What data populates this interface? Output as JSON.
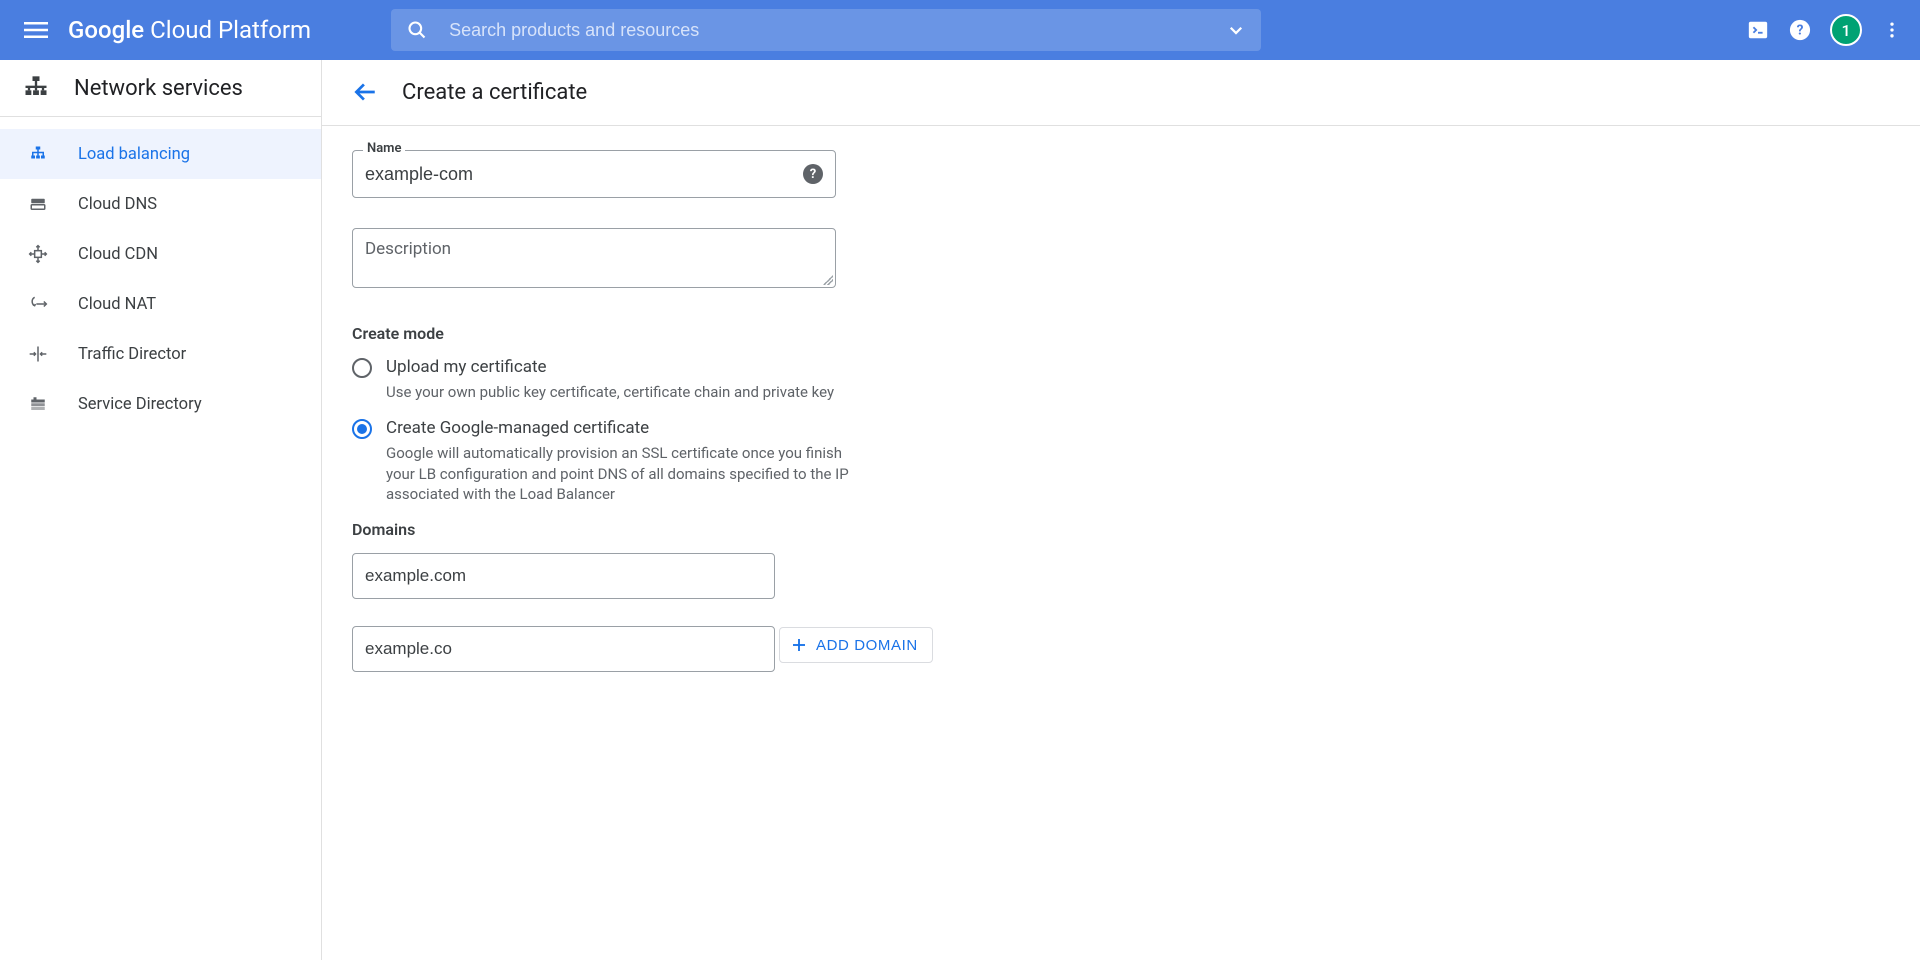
{
  "header": {
    "brand_prefix": "Google",
    "brand_rest": " Cloud Platform",
    "search_placeholder": "Search products and resources",
    "avatar_initial": "1"
  },
  "sidebar": {
    "section_title": "Network services",
    "items": [
      {
        "label": "Load balancing"
      },
      {
        "label": "Cloud DNS"
      },
      {
        "label": "Cloud CDN"
      },
      {
        "label": "Cloud NAT"
      },
      {
        "label": "Traffic Director"
      },
      {
        "label": "Service Directory"
      }
    ]
  },
  "page": {
    "title": "Create a certificate",
    "name_field_label": "Name",
    "name_value": "example-com",
    "description_placeholder": "Description",
    "create_mode_label": "Create mode",
    "radio_upload_label": "Upload my certificate",
    "radio_upload_help": "Use your own public key certificate, certificate chain and private key",
    "radio_managed_label": "Create Google-managed certificate",
    "radio_managed_help": "Google will automatically provision an SSL certificate once you finish your LB configuration and point DNS of all domains specified to the IP associated with the Load Balancer",
    "domains_label": "Domains",
    "domains": [
      "example.com",
      "example.co"
    ],
    "add_domain_label": "ADD DOMAIN"
  }
}
